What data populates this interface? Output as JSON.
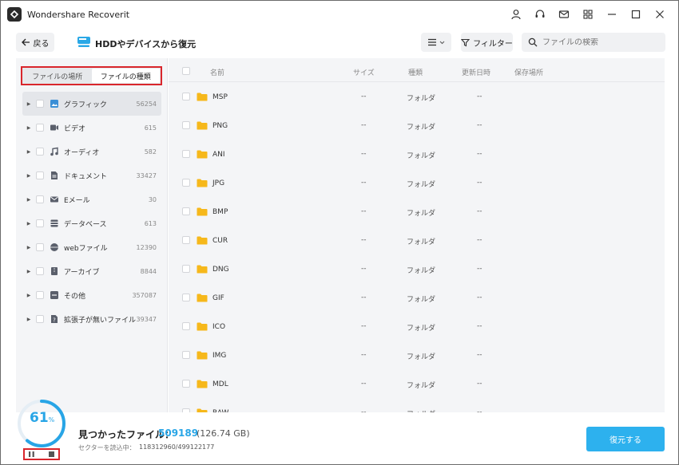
{
  "app": {
    "title": "Wondershare Recoverit"
  },
  "toolbar": {
    "back_label": "戻る",
    "page_title": "HDDやデバイスから復元",
    "filter_label": "フィルター",
    "search_placeholder": "ファイルの検索"
  },
  "sidebar": {
    "tabs": [
      {
        "label": "ファイルの場所",
        "active": false
      },
      {
        "label": "ファイルの種類",
        "active": true
      }
    ],
    "categories": [
      {
        "label": "グラフィック",
        "count": "56254",
        "icon": "image-icon",
        "color": "#3b8fd6"
      },
      {
        "label": "ビデオ",
        "count": "615",
        "icon": "video-icon",
        "color": "#5a5f6b"
      },
      {
        "label": "オーディオ",
        "count": "582",
        "icon": "audio-icon",
        "color": "#5a5f6b"
      },
      {
        "label": "ドキュメント",
        "count": "33427",
        "icon": "document-icon",
        "color": "#5a5f6b"
      },
      {
        "label": "Eメール",
        "count": "30",
        "icon": "email-icon",
        "color": "#5a5f6b"
      },
      {
        "label": "データベース",
        "count": "613",
        "icon": "database-icon",
        "color": "#5a5f6b"
      },
      {
        "label": "webファイル",
        "count": "12390",
        "icon": "web-icon",
        "color": "#5a5f6b"
      },
      {
        "label": "アーカイブ",
        "count": "8844",
        "icon": "archive-icon",
        "color": "#5a5f6b"
      },
      {
        "label": "その他",
        "count": "357087",
        "icon": "other-icon",
        "color": "#5a5f6b"
      },
      {
        "label": "拡張子が無いファイル",
        "count": "39347",
        "icon": "unknown-file-icon",
        "color": "#5a5f6b"
      }
    ]
  },
  "table": {
    "headers": {
      "name": "名前",
      "size": "サイズ",
      "type": "種類",
      "date": "更新日時",
      "path": "保存場所"
    },
    "rows": [
      {
        "name": "MSP",
        "size": "--",
        "type": "フォルダ",
        "date": "--"
      },
      {
        "name": "PNG",
        "size": "--",
        "type": "フォルダ",
        "date": "--"
      },
      {
        "name": "ANI",
        "size": "--",
        "type": "フォルダ",
        "date": "--"
      },
      {
        "name": "JPG",
        "size": "--",
        "type": "フォルダ",
        "date": "--"
      },
      {
        "name": "BMP",
        "size": "--",
        "type": "フォルダ",
        "date": "--"
      },
      {
        "name": "CUR",
        "size": "--",
        "type": "フォルダ",
        "date": "--"
      },
      {
        "name": "DNG",
        "size": "--",
        "type": "フォルダ",
        "date": "--"
      },
      {
        "name": "GIF",
        "size": "--",
        "type": "フォルダ",
        "date": "--"
      },
      {
        "name": "ICO",
        "size": "--",
        "type": "フォルダ",
        "date": "--"
      },
      {
        "name": "IMG",
        "size": "--",
        "type": "フォルダ",
        "date": "--"
      },
      {
        "name": "MDL",
        "size": "--",
        "type": "フォルダ",
        "date": "--"
      },
      {
        "name": "RAW",
        "size": "--",
        "type": "フォルダ",
        "date": "--"
      }
    ]
  },
  "footer": {
    "progress_value": "61",
    "progress_unit": "%",
    "progress_fraction": 0.61,
    "found_label": "見つかったファイル：",
    "found_count": "509189",
    "found_size": "(126.74 GB)",
    "sector_label": "セクターを読込中：",
    "sector_value": "118312960/499122177",
    "recover_label": "復元する"
  },
  "colors": {
    "accent": "#2db1ee",
    "highlight_border": "#d9262c",
    "folder": "#f6b81b"
  }
}
